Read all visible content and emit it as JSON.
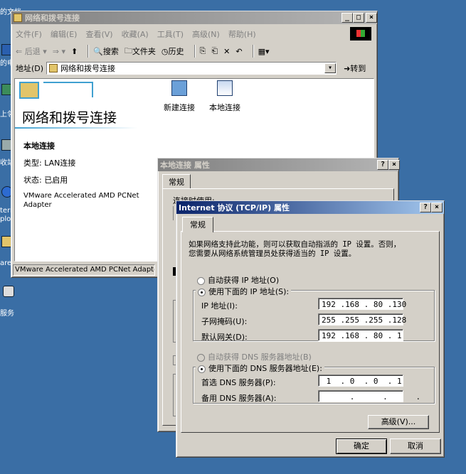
{
  "desktop": {
    "labels": [
      "的文档",
      "的电",
      "上邻",
      "收站",
      "ternet",
      "plor",
      "are",
      "服务"
    ]
  },
  "explorer": {
    "title": "网络和拨号连接",
    "title_buttons": [
      "_",
      "□",
      "×"
    ],
    "menu": [
      "文件(F)",
      "编辑(E)",
      "查看(V)",
      "收藏(A)",
      "工具(T)",
      "高级(N)",
      "帮助(H)"
    ],
    "toolbar": {
      "back": "后退",
      "search": "搜索",
      "folders": "文件夹",
      "history": "历史"
    },
    "address": {
      "label": "地址(D)",
      "value": "网络和拨号连接",
      "go": "转到"
    },
    "heading": "网络和拨号连接",
    "icons": [
      {
        "label": "新建连接"
      },
      {
        "label": "本地连接"
      }
    ],
    "details": {
      "name": "本地连接",
      "type": "类型: LAN连接",
      "status": "状态: 已启用",
      "device": "VMware Accelerated AMD PCNet Adapter"
    },
    "statusbar": "VMware Accelerated AMD PCNet Adapter"
  },
  "properties": {
    "title": "本地连接 属性",
    "buttons": [
      "?",
      "×"
    ],
    "tab": "常规",
    "connect_label": "连接时使用:"
  },
  "tcpip": {
    "title": "Internet 协议 (TCP/IP) 属性",
    "buttons": [
      "?",
      "×"
    ],
    "tab": "常规",
    "description": "如果网络支持此功能，则可以获取自动指派的 IP 设置。否则，\n您需要从网络系统管理员处获得适当的 IP 设置。",
    "ip_auto": "自动获得 IP 地址(O)",
    "ip_manual": "使用下面的 IP 地址(S):",
    "ip_label": "IP 地址(I):",
    "ip_value": "192 .168 . 80 .130",
    "mask_label": "子网掩码(U):",
    "mask_value": "255 .255 .255 .128",
    "gateway_label": "默认网关(D):",
    "gateway_value": "192 .168 . 80 . 1",
    "dns_auto": "自动获得 DNS 服务器地址(B)",
    "dns_manual": "使用下面的 DNS 服务器地址(E):",
    "dns_pref_label": "首选 DNS 服务器(P):",
    "dns_pref_value": " 1  . 0  . 0  . 1",
    "dns_alt_label": "备用 DNS 服务器(A):",
    "dns_alt_value": "      .      .      .",
    "advanced": "高级(V)...",
    "ok": "确定",
    "cancel": "取消"
  },
  "colors": {
    "desktop": "#3a6ea5",
    "title_active": "#0a246a",
    "title_inactive": "#808080",
    "face": "#d4d0c8"
  }
}
